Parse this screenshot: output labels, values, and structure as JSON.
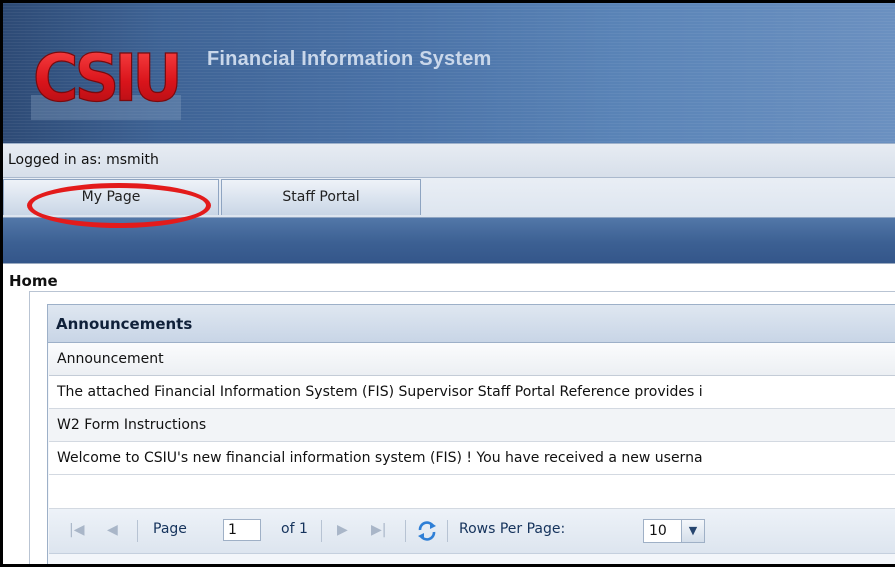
{
  "app": {
    "title": "Financial Information System",
    "logo_text": "CSIU"
  },
  "session": {
    "logged_in_text": "Logged in as: msmith"
  },
  "tabs": [
    {
      "label": "My Page",
      "highlighted": true
    },
    {
      "label": "Staff Portal",
      "highlighted": false
    }
  ],
  "home": {
    "title": "Home",
    "announcements": {
      "panel_title": "Announcements",
      "column_header": "Announcement",
      "rows": [
        "The attached Financial Information System (FIS) Supervisor Staff Portal Reference provides i",
        "W2 Form Instructions",
        "Welcome to CSIU's new financial information system (FIS) ! You have received a new userna"
      ]
    },
    "pager": {
      "page_label": "Page",
      "page_value": "1",
      "of_label": "of 1",
      "rows_per_page_label": "Rows Per Page:",
      "rows_per_page_value": "10"
    }
  },
  "colors": {
    "highlight": "#e31b1b",
    "banner": "#3e6395"
  }
}
